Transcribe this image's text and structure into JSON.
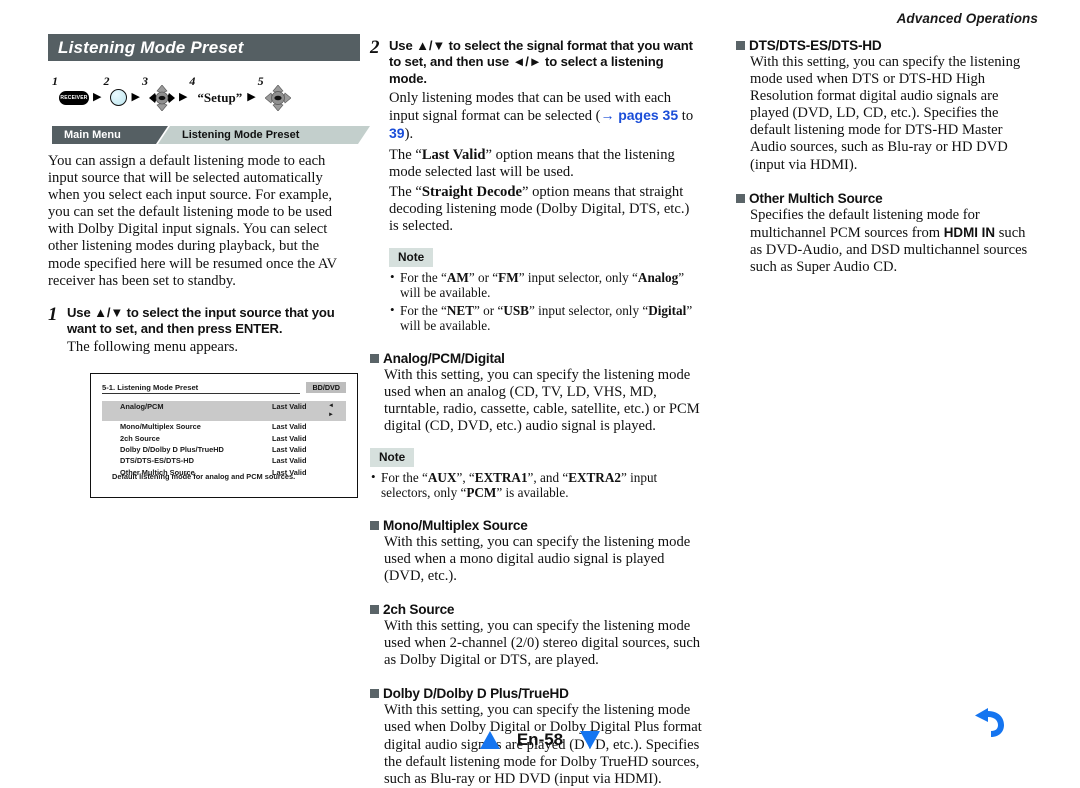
{
  "running_head": "Advanced Operations",
  "section": {
    "title": "Listening Mode Preset",
    "operation_steps": [
      {
        "num": "1",
        "icon": "receiver-button",
        "label": "RECEIVER"
      },
      {
        "num": "2",
        "icon": "home-button",
        "label": ""
      },
      {
        "num": "3",
        "icon": "dpad-left-right",
        "label": ""
      },
      {
        "num": "4",
        "icon": "text-label",
        "label": "“Setup”"
      },
      {
        "num": "5",
        "icon": "dpad-enter",
        "label": ""
      }
    ],
    "arrow_glyph": "▶",
    "breadcrumb": {
      "level1": "Main Menu",
      "level2": "Listening Mode Preset"
    },
    "intro": "You can assign a default listening mode to each input source that will be selected automatically when you select each input source. For example, you can set the default listening mode to be used with Dolby Digital input signals. You can select other listening modes during playback, but the mode specified here will be resumed once the AV receiver has been set to standby."
  },
  "step1": {
    "num": "1",
    "lead_a": "Use ",
    "lead_updown": "▲/▼",
    "lead_b": " to select the input source that you want to set, and then press ",
    "lead_bold": "ENTER",
    "lead_end": ".",
    "sub": "The following menu appears."
  },
  "osd": {
    "title": "5-1. Listening Mode Preset",
    "badge": "BD/DVD",
    "lr_arrows": "◄ ►",
    "rows": [
      {
        "label": "Analog/PCM",
        "value": "Last Valid",
        "selected": true
      },
      {
        "label": "Mono/Multiplex Source",
        "value": "Last Valid",
        "selected": false
      },
      {
        "label": "2ch Source",
        "value": "Last Valid",
        "selected": false
      },
      {
        "label": "Dolby D/Dolby D Plus/TrueHD",
        "value": "Last Valid",
        "selected": false
      },
      {
        "label": "DTS/DTS-ES/DTS-HD",
        "value": "Last Valid",
        "selected": false
      },
      {
        "label": "Other Multich Source",
        "value": "Last Valid",
        "selected": false
      }
    ],
    "footer": "Default listening mode for analog and PCM sources."
  },
  "step2": {
    "num": "2",
    "lead_a": "Use ",
    "lead_updown": "▲/▼",
    "lead_b": " to select the signal format that you want to set, and then use ",
    "lead_leftright": "◄/►",
    "lead_c": " to select a listening mode.",
    "p1_a": "Only listening modes that can be used with each input signal format can be selected (",
    "p1_ref_arrow": "→",
    "p1_ref_pages": "pages 35",
    "p1_ref_mid": " to ",
    "p1_ref_39": "39",
    "p1_end": ").",
    "p2_a": "The “",
    "p2_bold": "Last Valid",
    "p2_b": "” option means that the listening mode selected last will be used.",
    "p3_a": "The “",
    "p3_bold": "Straight Decode",
    "p3_b": "” option means that straight decoding listening mode (Dolby Digital, DTS, etc.) is selected."
  },
  "note_step2": {
    "tag": "Note",
    "items": [
      {
        "pre": "For the “",
        "b1": "AM",
        "mid": "” or “",
        "b2": "FM",
        "post": "” input selector, only “",
        "b3": "Analog",
        "tail": "” will be available."
      },
      {
        "pre": "For the “",
        "b1": "NET",
        "mid": "” or “",
        "b2": "USB",
        "post": "” input selector, only “",
        "b3": "Digital",
        "tail": "” will be available."
      }
    ]
  },
  "sections": [
    {
      "heading": "Analog/PCM/Digital",
      "body": "With this setting, you can specify the listening mode used when an analog (CD, TV, LD, VHS, MD, turntable, radio, cassette, cable, satellite, etc.) or PCM digital (CD, DVD, etc.) audio signal is played."
    },
    {
      "heading": "Mono/Multiplex Source",
      "body": "With this setting, you can specify the listening mode used when a mono digital audio signal is played (DVD, etc.)."
    },
    {
      "heading": "2ch Source",
      "body": "With this setting, you can specify the listening mode used when 2-channel (2/0) stereo digital sources, such as Dolby Digital or DTS, are played."
    },
    {
      "heading": "Dolby D/Dolby D Plus/TrueHD",
      "body": "With this setting, you can specify the listening mode used when Dolby Digital or Dolby Digital Plus format digital audio signals are played (DVD, etc.). Specifies the default listening mode for Dolby TrueHD sources, such as Blu-ray or HD DVD (input via HDMI)."
    },
    {
      "heading": "DTS/DTS-ES/DTS-HD",
      "body": "With this setting, you can specify the listening mode used when DTS or DTS-HD High Resolution format digital audio signals are played (DVD, LD, CD, etc.). Specifies the default listening mode for DTS-HD Master Audio sources, such as Blu-ray or HD DVD (input via HDMI)."
    },
    {
      "heading": "Other Multich Source",
      "body_a": "Specifies the default listening mode for multichannel PCM sources from ",
      "body_bold": "HDMI IN",
      "body_b": " such as DVD-Audio, and DSD multichannel sources such as Super Audio CD."
    }
  ],
  "note_analog": {
    "tag": "Note",
    "item": {
      "pre": "For the “",
      "b1": "AUX",
      "mid": "”, “",
      "b2": "EXTRA1",
      "mid2": "”, and “",
      "b3": "EXTRA2",
      "post": "” input selectors, only “",
      "b4": "PCM",
      "tail": "” is available."
    }
  },
  "footer": {
    "page": "En-58",
    "up_arrow": "up-triangle",
    "down_arrow": "down-triangle",
    "back_icon": "back-arrow-icon"
  },
  "colors": {
    "title_bar": "#555f63",
    "crumb_dark": "#555f63",
    "crumb_light": "#c3cfcc",
    "note_tag": "#d6e0dd",
    "link_blue": "#1b4ed8",
    "footer_blue": "#1575f0",
    "osd_selected": "#c9c9c9",
    "osd_badge": "#bdbdbd"
  }
}
